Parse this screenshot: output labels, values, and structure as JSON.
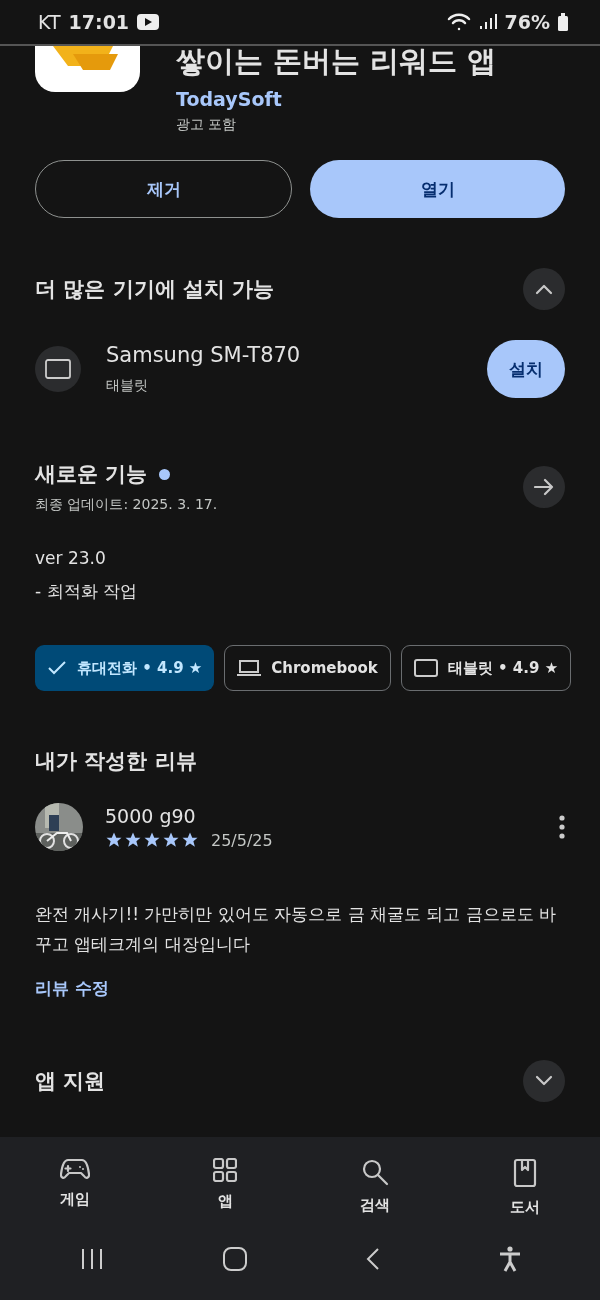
{
  "status_bar": {
    "carrier": "KT",
    "time": "17:01",
    "battery": "76%"
  },
  "app": {
    "title": "쌓이는 돈버는 리워드 앱",
    "developer": "TodaySoft",
    "note": "광고 포함"
  },
  "actions": [
    {
      "label": "제거",
      "kind": "outline"
    },
    {
      "label": "열기",
      "kind": "filled"
    }
  ],
  "more_devices": {
    "title": "더 많은 기기에 설치 가능",
    "expanded": true,
    "devices": [
      {
        "name": "Samsung SM-T870",
        "type": "태블릿",
        "button": "설치"
      }
    ]
  },
  "whats_new": {
    "title": "새로운 기능",
    "updated": "최종 업데이트: 2025. 3. 17.",
    "lines": [
      "ver 23.0",
      "- 최적화 작업"
    ]
  },
  "device_chips": [
    {
      "label": "휴대전화 • 4.9 ★",
      "kind": "phone",
      "selected": true
    },
    {
      "label": "Chromebook",
      "kind": "laptop",
      "selected": false
    },
    {
      "label": "태블릿 • 4.9 ★",
      "kind": "tablet",
      "selected": false
    }
  ],
  "my_review": {
    "title": "내가 작성한 리뷰",
    "author": "5000 g90",
    "stars": 5,
    "date": "25/5/25",
    "text": "완전 개사기!! 가만히만 있어도 자동으로 금 채굴도 되고 금으로도 바꾸고 앱테크계의 대장입니다",
    "edit": "리뷰 수정"
  },
  "app_support": {
    "title": "앱 지원",
    "expanded": false
  },
  "bottom_nav": [
    {
      "label": "게임",
      "kind": "games"
    },
    {
      "label": "앱",
      "kind": "apps"
    },
    {
      "label": "검색",
      "kind": "search"
    },
    {
      "label": "도서",
      "kind": "books"
    }
  ]
}
